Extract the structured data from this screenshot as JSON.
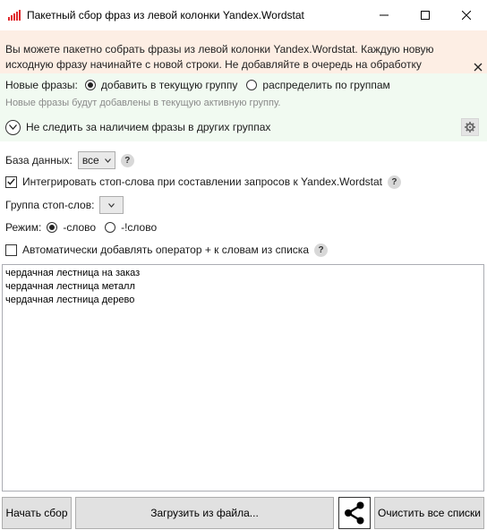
{
  "window": {
    "title": "Пакетный сбор фраз из левой колонки Yandex.Wordstat"
  },
  "notice": {
    "text": "Вы можете пакетно собрать фразы из левой колонки Yandex.Wordstat. Каждую новую исходную фразу начинайте с новой строки. Не добавляйте в очередь на обработку ненужные фразы!"
  },
  "new_phrases": {
    "label": "Новые фразы:",
    "options": [
      "добавить в текущую группу",
      "распределить по группам"
    ],
    "selected": "добавить в текущую группу",
    "hint": "Новые фразы будут добавлены в текущую активную группу."
  },
  "other_groups": {
    "label": "Не следить за наличием фразы в других группах"
  },
  "database": {
    "label": "База данных:",
    "value": "все"
  },
  "stopwords_integration": {
    "label": "Интегрировать стоп-слова при составлении запросов к Yandex.Wordstat",
    "checked": true
  },
  "stopword_group": {
    "label": "Группа стоп-слов:",
    "value": ""
  },
  "mode": {
    "label": "Режим:",
    "options": [
      "-слово",
      "-!слово"
    ],
    "selected": "-слово"
  },
  "auto_plus": {
    "label": "Автоматически добавлять оператор + к словам из списка",
    "checked": false
  },
  "phrases": [
    "чердачная лестница на заказ",
    "чердачная лестница металл",
    "чердачная лестница дерево"
  ],
  "buttons": {
    "start": "Начать сбор",
    "load": "Загрузить из файла...",
    "clear": "Очистить все списки"
  },
  "icons": {
    "app": "bar-chart-icon",
    "share": "share-icon",
    "settings": "gear-icon",
    "help": "question-icon",
    "expand": "chevron-down-icon"
  },
  "colors": {
    "notice_bg": "#fdeee4",
    "group_panel_bg": "#f1faf1",
    "app_icon": "#e0262b"
  }
}
